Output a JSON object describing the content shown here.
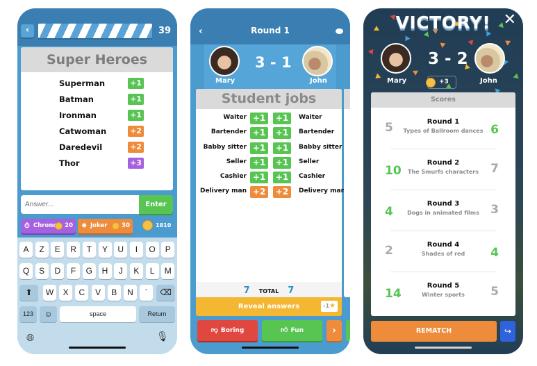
{
  "screen1": {
    "timer_value": "39",
    "category_title": "Super Heroes",
    "answers": [
      {
        "name": "Superman",
        "points": "+1",
        "tier": "g"
      },
      {
        "name": "Batman",
        "points": "+1",
        "tier": "g"
      },
      {
        "name": "Ironman",
        "points": "+1",
        "tier": "g"
      },
      {
        "name": "Catwoman",
        "points": "+2",
        "tier": "o"
      },
      {
        "name": "Daredevil",
        "points": "+2",
        "tier": "o"
      },
      {
        "name": "Thor",
        "points": "+3",
        "tier": "pu"
      }
    ],
    "answer_placeholder": "Answer...",
    "enter_label": "Enter",
    "powerups": [
      {
        "label": "Chrono",
        "cost": "20",
        "icon": "stopwatch-icon"
      },
      {
        "label": "Joker",
        "cost": "30",
        "icon": "lightbulb-icon"
      }
    ],
    "coin_balance": "1810",
    "keyboard": {
      "row1": [
        "A",
        "Z",
        "E",
        "R",
        "T",
        "Y",
        "U",
        "I",
        "O",
        "P"
      ],
      "row2": [
        "Q",
        "S",
        "D",
        "F",
        "G",
        "H",
        "J",
        "K",
        "L",
        "M"
      ],
      "row3": [
        "W",
        "X",
        "C",
        "V",
        "B",
        "N",
        "´"
      ],
      "numbers_label": "123",
      "space_label": "space",
      "return_label": "Return"
    }
  },
  "screen2": {
    "title": "Round 1",
    "player_left": "Mary",
    "player_right": "John",
    "score": "3 - 1",
    "category_title": "Student jobs",
    "rows": [
      {
        "left": "Waiter",
        "left_points": "+1",
        "right_points": "+1",
        "right": "Waiter",
        "tier": "g"
      },
      {
        "left": "Bartender",
        "left_points": "+1",
        "right_points": "+1",
        "right": "Bartender",
        "tier": "g"
      },
      {
        "left": "Babby sitter",
        "left_points": "+1",
        "right_points": "+1",
        "right": "Babby sitter",
        "tier": "g"
      },
      {
        "left": "Seller",
        "left_points": "+1",
        "right_points": "+1",
        "right": "Seller",
        "tier": "g"
      },
      {
        "left": "Cashier",
        "left_points": "+1",
        "right_points": "+1",
        "right": "Cashier",
        "tier": "g"
      },
      {
        "left": "Delivery man",
        "left_points": "+2",
        "right_points": "+2",
        "right": "Delivery man",
        "tier": "o"
      }
    ],
    "total_left": "7",
    "total_label": "TOTAL",
    "total_right": "7",
    "reveal_label": "Reveal answers",
    "reveal_cost": "-1",
    "boring_label": "Boring",
    "fun_label": "Fun"
  },
  "screen3": {
    "headline": "VICTORY!",
    "player_left": "Mary",
    "player_right": "John",
    "score": "3 - 2",
    "coin_reward": "+3",
    "scores_header": "Scores",
    "rounds": [
      {
        "title": "Round 1",
        "category": "Types of Ballroom dances",
        "left": "5",
        "right": "6",
        "winner": "right"
      },
      {
        "title": "Round 2",
        "category": "The Smurfs characters",
        "left": "10",
        "right": "7",
        "winner": "left"
      },
      {
        "title": "Round 3",
        "category": "Dogs in animated films",
        "left": "4",
        "right": "3",
        "winner": "left"
      },
      {
        "title": "Round 4",
        "category": "Shades of red",
        "left": "2",
        "right": "4",
        "winner": "right"
      },
      {
        "title": "Round 5",
        "category": "Winter sports",
        "left": "14",
        "right": "5",
        "winner": "left"
      }
    ],
    "rematch_label": "REMATCH"
  },
  "colors": {
    "app_blue": "#4b9bcf",
    "header_blue": "#3b7fb2",
    "green": "#58c553",
    "orange": "#ef8c3c",
    "purple": "#a561e0",
    "red": "#e0473f",
    "yellow": "#f4b731",
    "share_blue": "#2f63dd"
  }
}
